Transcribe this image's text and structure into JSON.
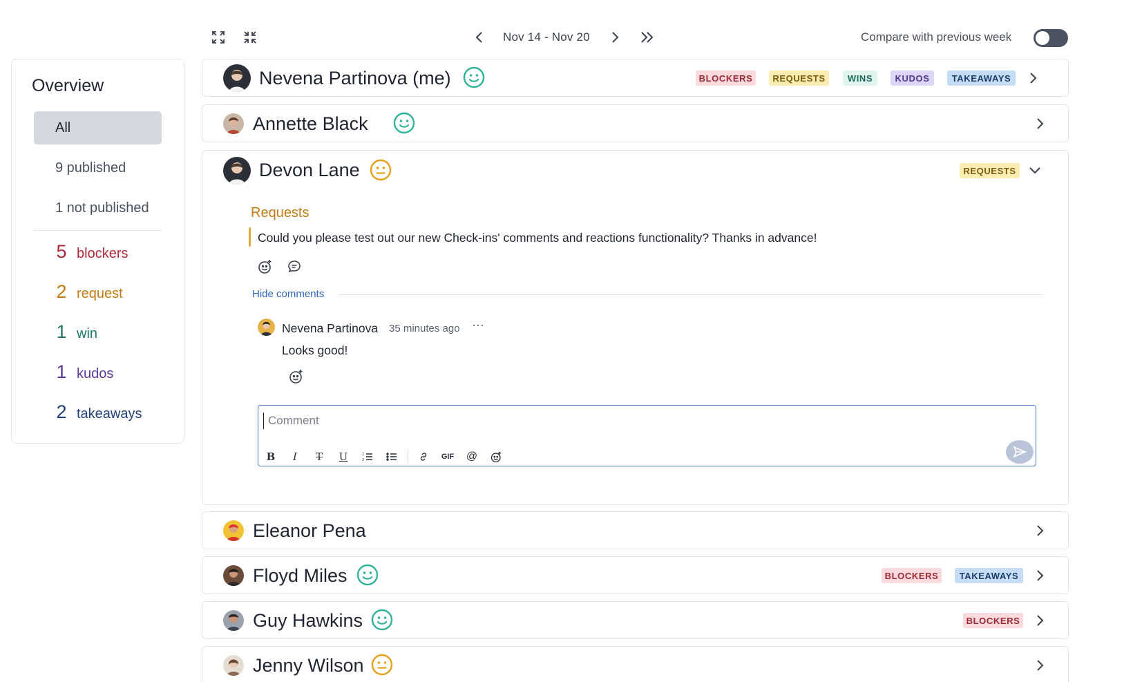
{
  "toolbar": {
    "expand_icon": "expand-icon",
    "collapse_icon": "collapse-icon",
    "date_range": "Nov 14 - Nov 20",
    "compare_label": "Compare with previous week",
    "compare_enabled": false
  },
  "sidebar": {
    "title": "Overview",
    "filters": [
      {
        "label": "All",
        "active": true
      },
      {
        "label": "9 published",
        "active": false
      },
      {
        "label": "1 not published",
        "active": false
      }
    ],
    "counts": [
      {
        "num": "5",
        "label": "blockers",
        "color": "#b0293a"
      },
      {
        "num": "2",
        "label": "request",
        "color": "#c47b13"
      },
      {
        "num": "1",
        "label": "win",
        "color": "#1d7a6b"
      },
      {
        "num": "1",
        "label": "kudos",
        "color": "#5b3aa0"
      },
      {
        "num": "2",
        "label": "takeaways",
        "color": "#1f3f78"
      }
    ]
  },
  "tags": {
    "blockers": "BLOCKERS",
    "requests": "REQUESTS",
    "wins": "WINS",
    "kudos": "KUDOS",
    "takeaways": "TAKEAWAYS"
  },
  "people": [
    {
      "name": "Nevena Partinova (me)",
      "mood": "happy"
    },
    {
      "name": "Annette Black",
      "mood": "happy"
    },
    {
      "name": "Devon Lane",
      "mood": "neutral"
    },
    {
      "name": "Eleanor Pena",
      "mood": "none"
    },
    {
      "name": "Floyd Miles",
      "mood": "happy"
    },
    {
      "name": "Guy Hawkins",
      "mood": "happy"
    },
    {
      "name": "Jenny Wilson",
      "mood": "neutral"
    }
  ],
  "expanded": {
    "section_heading": "Requests",
    "request_text": "Could you please test out our new Check-ins' comments and reactions functionality? Thanks in advance!",
    "hide_comments": "Hide comments",
    "comment": {
      "author": "Nevena Partinova",
      "time": "35 minutes ago",
      "more": "···",
      "body": "Looks good!"
    },
    "comment_placeholder": "Comment",
    "gif_label": "GIF"
  },
  "colors": {
    "happy": "#2fb39a",
    "neutral": "#e3a21a",
    "link": "#2e65c0",
    "accent_border": "#4c7fd1"
  }
}
